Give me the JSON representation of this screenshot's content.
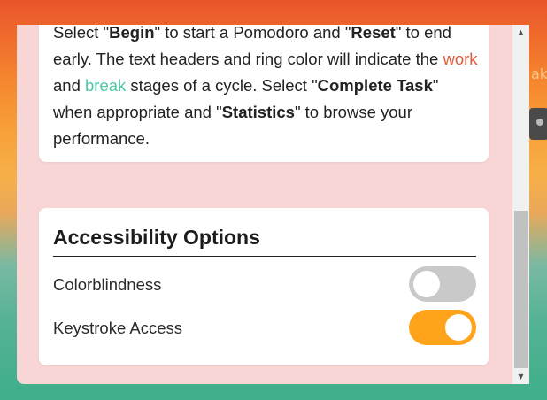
{
  "background": {
    "right_partial_text": "ak"
  },
  "instructions_card": {
    "t1": "Select \"",
    "begin": "Begin",
    "t2": "\" to start a Pomodoro and \"",
    "reset": "Reset",
    "t3": "\" to end early. The text headers and ring color will indicate the ",
    "work": "work",
    "t4": " and ",
    "break": "break",
    "t5": " stages of a cycle. Select \"",
    "complete_task": "Complete Task",
    "t6": "\" when appropriate and \"",
    "statistics": "Statistics",
    "t7": "\" to browse your performance."
  },
  "accessibility": {
    "title": "Accessibility Options",
    "options": [
      {
        "label": "Colorblindness",
        "enabled": false
      },
      {
        "label": "Keystroke Access",
        "enabled": true
      }
    ]
  },
  "colors": {
    "work": "#e0593a",
    "break": "#4fc4a7",
    "toggle_on": "#ffa31a",
    "toggle_off": "#c9c9c9",
    "modal_bg": "#f8d6d6"
  },
  "scrollbar": {
    "up_icon": "triangle-up",
    "down_icon": "triangle-down"
  }
}
